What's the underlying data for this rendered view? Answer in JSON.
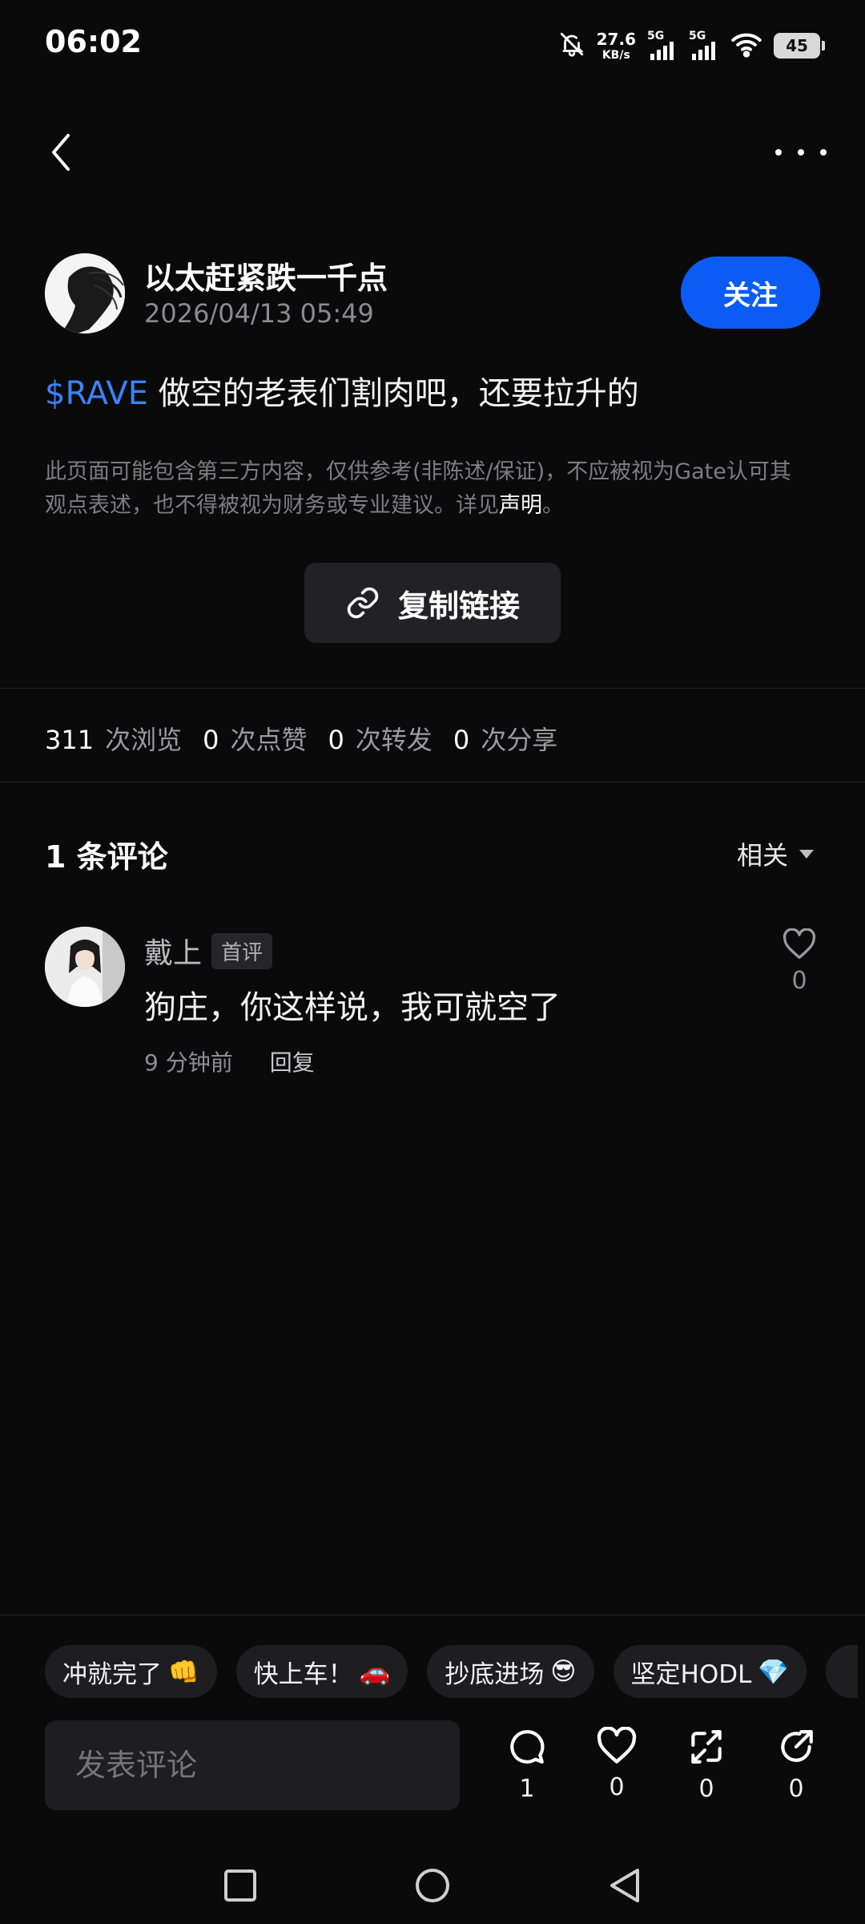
{
  "status_bar": {
    "time": "06:02",
    "net_speed_value": "27.6",
    "net_speed_unit": "KB/s",
    "signal1_label": "5G",
    "signal2_label": "5G",
    "battery": "45"
  },
  "post": {
    "author": "以太赶紧跌一千点",
    "timestamp": "2026/04/13 05:49",
    "follow_label": "关注",
    "ticker": "$RAVE",
    "text": " 做空的老表们割肉吧，还要拉升的",
    "disclaimer_line1": "此页面可能包含第三方内容，仅供参考(非陈述/保证)，不应被视为Gate认可其",
    "disclaimer_line2": "观点表述，也不得被视为财务或专业建议。详见",
    "disclaimer_link": "声明",
    "disclaimer_end": "。",
    "copy_link_label": "复制链接"
  },
  "stats": {
    "views": "311",
    "views_label": "次浏览",
    "likes": "0",
    "likes_label": "次点赞",
    "reposts": "0",
    "reposts_label": "次转发",
    "shares": "0",
    "shares_label": "次分享"
  },
  "comments": {
    "title": "1 条评论",
    "sort_label": "相关",
    "items": [
      {
        "user": "戴上",
        "badge": "首评",
        "text": "狗庄，你这样说，我可就空了",
        "time": "9 分钟前",
        "reply_label": "回复",
        "likes": "0"
      }
    ]
  },
  "quick_replies": [
    {
      "text": "冲就完了",
      "emoji": "👊"
    },
    {
      "text": "快上车！",
      "emoji": "🚗"
    },
    {
      "text": "抄底进场",
      "emoji": "😎"
    },
    {
      "text": "坚定HODL",
      "emoji": "💎"
    }
  ],
  "composer": {
    "placeholder": "发表评论",
    "comment_count": "1",
    "like_count": "0",
    "repost_count": "0",
    "share_count": "0"
  },
  "colors": {
    "background": "#0a0a0b",
    "accent": "#0b5cf5",
    "ticker": "#3b82f6"
  },
  "icons": [
    "back-icon",
    "more-icon",
    "link-icon",
    "heart-icon",
    "comment-icon",
    "repost-icon",
    "share-icon",
    "nav-recents-icon",
    "nav-home-icon",
    "nav-back-icon"
  ]
}
